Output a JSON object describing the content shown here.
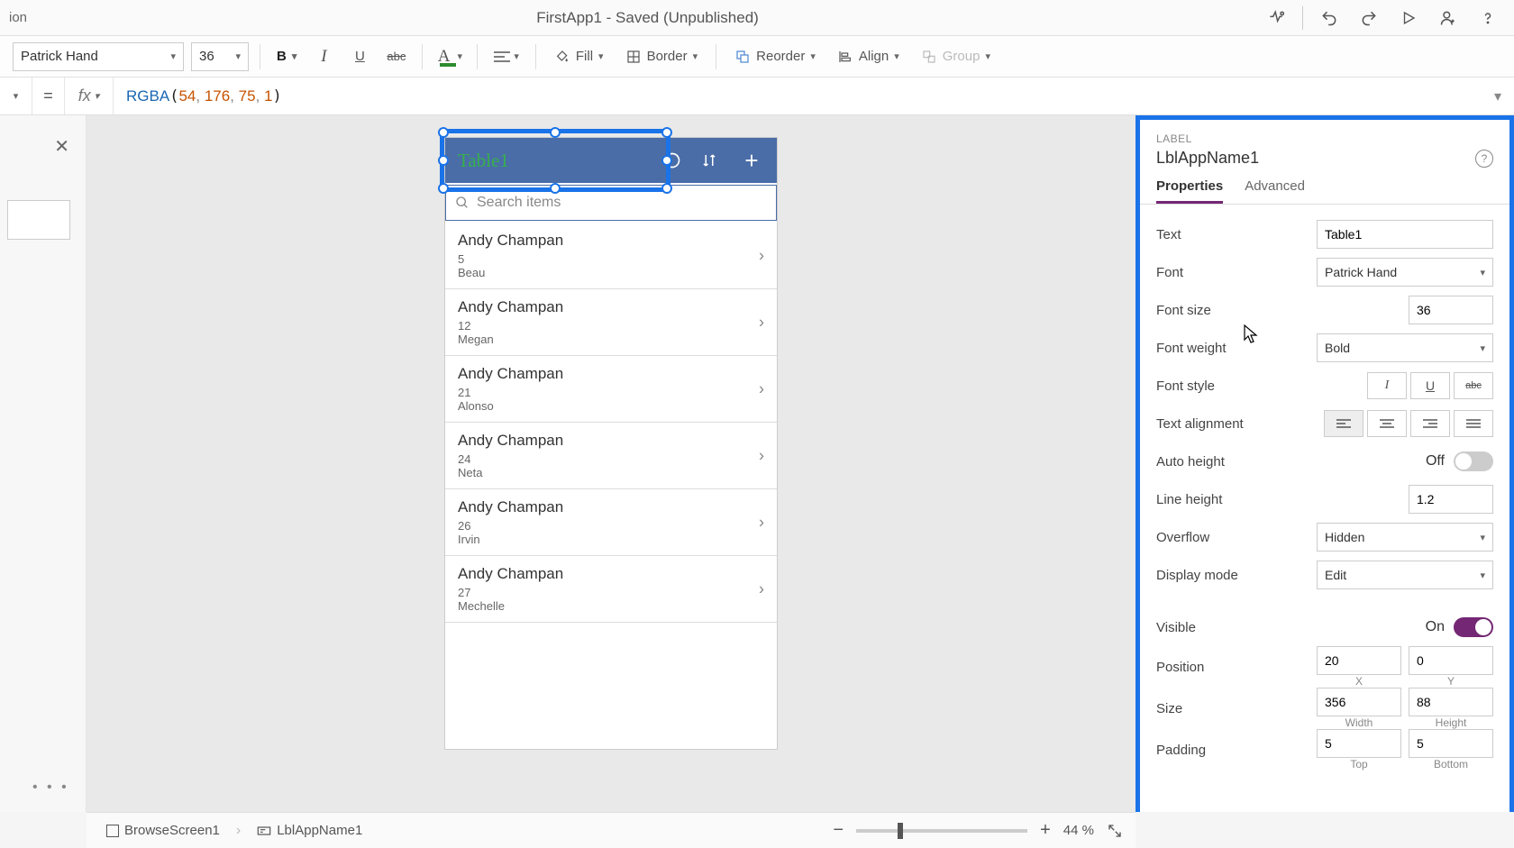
{
  "titlebar": {
    "left_text": "ion",
    "center": "FirstApp1 - Saved (Unpublished)"
  },
  "toolbar": {
    "font": "Patrick Hand",
    "size": "36",
    "fill": "Fill",
    "border": "Border",
    "reorder": "Reorder",
    "align": "Align",
    "group": "Group"
  },
  "formula": {
    "eq": "=",
    "fx": "fx",
    "fn": "RGBA",
    "a1": "54",
    "a2": "176",
    "a3": "75",
    "a4": "1"
  },
  "phone": {
    "title": "Table1",
    "search_placeholder": "Search items",
    "items": [
      {
        "name": "Andy Champan",
        "line2": "5",
        "line3": "Beau"
      },
      {
        "name": "Andy Champan",
        "line2": "12",
        "line3": "Megan"
      },
      {
        "name": "Andy Champan",
        "line2": "21",
        "line3": "Alonso"
      },
      {
        "name": "Andy Champan",
        "line2": "24",
        "line3": "Neta"
      },
      {
        "name": "Andy Champan",
        "line2": "26",
        "line3": "Irvin"
      },
      {
        "name": "Andy Champan",
        "line2": "27",
        "line3": "Mechelle"
      }
    ]
  },
  "props": {
    "type": "LABEL",
    "name": "LblAppName1",
    "tab_properties": "Properties",
    "tab_advanced": "Advanced",
    "rows": {
      "text_label": "Text",
      "text_value": "Table1",
      "font_label": "Font",
      "font_value": "Patrick Hand",
      "fontsize_label": "Font size",
      "fontsize_value": "36",
      "fontweight_label": "Font weight",
      "fontweight_value": "Bold",
      "fontstyle_label": "Font style",
      "textalign_label": "Text alignment",
      "autoheight_label": "Auto height",
      "autoheight_value": "Off",
      "lineheight_label": "Line height",
      "lineheight_value": "1.2",
      "overflow_label": "Overflow",
      "overflow_value": "Hidden",
      "displaymode_label": "Display mode",
      "displaymode_value": "Edit",
      "visible_label": "Visible",
      "visible_value": "On",
      "position_label": "Position",
      "position_x": "20",
      "position_y": "0",
      "position_x_sub": "X",
      "position_y_sub": "Y",
      "size_label": "Size",
      "size_w": "356",
      "size_h": "88",
      "size_w_sub": "Width",
      "size_h_sub": "Height",
      "padding_label": "Padding",
      "padding_t": "5",
      "padding_r": "5",
      "padding_t_sub": "Top",
      "padding_r_sub": "Bottom"
    }
  },
  "status": {
    "crumb1": "BrowseScreen1",
    "crumb2": "LblAppName1",
    "zoom": "44",
    "pct": "%"
  }
}
